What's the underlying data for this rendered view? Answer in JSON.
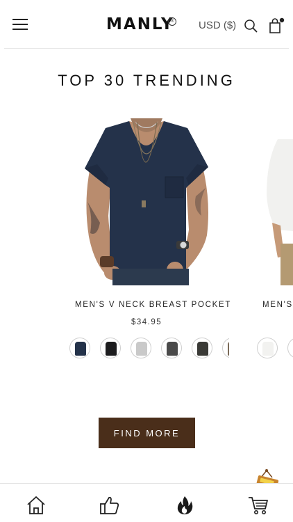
{
  "header": {
    "brand": "MANLY",
    "brand_mark": "®",
    "currency": "USD ($)"
  },
  "section": {
    "title": "TOP 30 TRENDING"
  },
  "products": [
    {
      "name": "MEN'S V NECK BREAST POCKET",
      "price": "$34.95",
      "swatch_colors": [
        "#24324a",
        "#1c1c1e",
        "#c9c9c9",
        "#4a4a4a",
        "#3a3a36",
        "#7a6a58"
      ]
    },
    {
      "name": "MEN'S",
      "swatch_colors": [
        "#f2f2f0",
        "#d8d8d8"
      ]
    }
  ],
  "actions": {
    "find_more_label": "FIND MORE"
  },
  "bottom_nav": {
    "items": [
      "home-icon",
      "thumbs-up-icon",
      "fire-icon",
      "cart-icon"
    ]
  },
  "colors": {
    "accent": "#4a2e1a",
    "shirt_navy": "#24324a"
  }
}
